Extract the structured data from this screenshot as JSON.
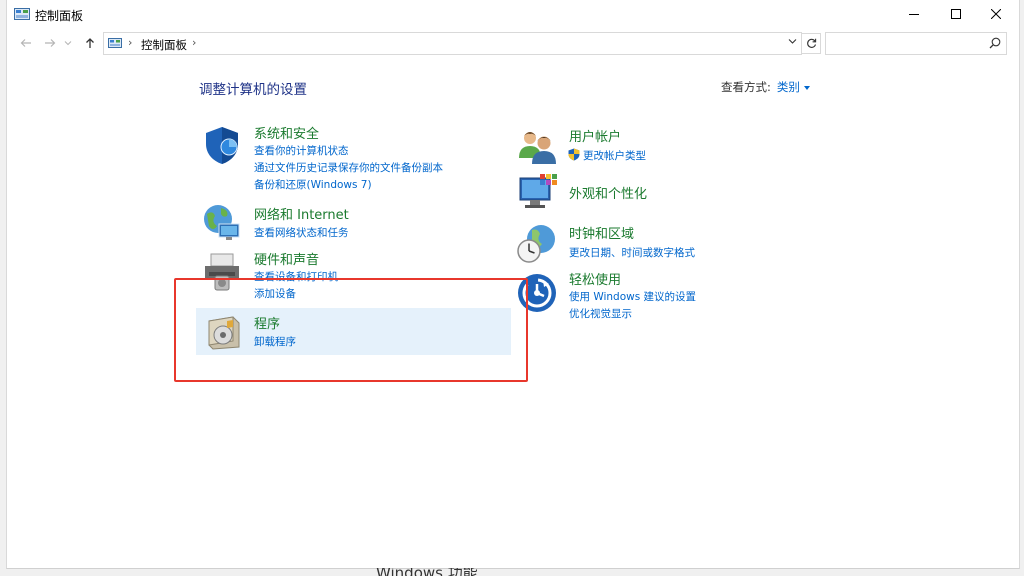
{
  "window": {
    "title": "控制面板",
    "controls": {
      "minimize": "minimize",
      "maximize": "maximize",
      "close": "close"
    }
  },
  "nav": {
    "breadcrumb": [
      "控制面板"
    ],
    "search_placeholder": ""
  },
  "content": {
    "heading": "调整计算机的设置",
    "view_by_label": "查看方式:",
    "view_by_value": "类别"
  },
  "categories": {
    "system_security": {
      "title": "系统和安全",
      "icon": "shield-icon",
      "links": [
        "查看你的计算机状态",
        "通过文件历史记录保存你的文件备份副本",
        "备份和还原(Windows 7)"
      ]
    },
    "network": {
      "title": "网络和 Internet",
      "icon": "globe-network-icon",
      "links": [
        "查看网络状态和任务"
      ]
    },
    "hardware_sound": {
      "title": "硬件和声音",
      "icon": "printer-speaker-icon",
      "links": [
        "查看设备和打印机",
        "添加设备"
      ]
    },
    "programs": {
      "title": "程序",
      "icon": "programs-disc-icon",
      "links": [
        "卸载程序"
      ]
    },
    "user_accounts": {
      "title": "用户帐户",
      "icon": "users-icon",
      "links": [
        "更改帐户类型"
      ]
    },
    "appearance": {
      "title": "外观和个性化",
      "icon": "monitor-palette-icon",
      "links": []
    },
    "clock_region": {
      "title": "时钟和区域",
      "icon": "clock-globe-icon",
      "links": [
        "更改日期、时间或数字格式"
      ]
    },
    "ease_access": {
      "title": "轻松使用",
      "icon": "ease-of-access-icon",
      "links": [
        "使用 Windows 建议的设置",
        "优化视觉显示"
      ]
    }
  },
  "background": {
    "partial_text": "Windows 功能"
  },
  "colors": {
    "heading": "#1e3287",
    "category_title": "#1a7a2e",
    "link": "#0066cc",
    "highlight": "#e5f1fb",
    "annotation_box": "#e8372c"
  }
}
